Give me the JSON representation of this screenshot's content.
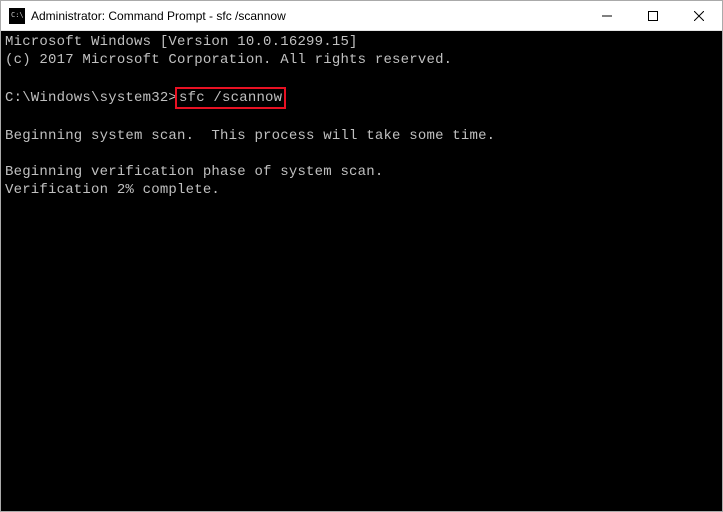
{
  "titlebar": {
    "title": "Administrator: Command Prompt - sfc  /scannow"
  },
  "terminal": {
    "line1": "Microsoft Windows [Version 10.0.16299.15]",
    "line2": "(c) 2017 Microsoft Corporation. All rights reserved.",
    "blank1": "",
    "prompt_prefix": "C:\\Windows\\system32>",
    "command_highlighted": "sfc /scannow",
    "blank2": "",
    "line_scan": "Beginning system scan.  This process will take some time.",
    "blank3": "",
    "line_verify": "Beginning verification phase of system scan.",
    "line_progress": "Verification 2% complete."
  }
}
